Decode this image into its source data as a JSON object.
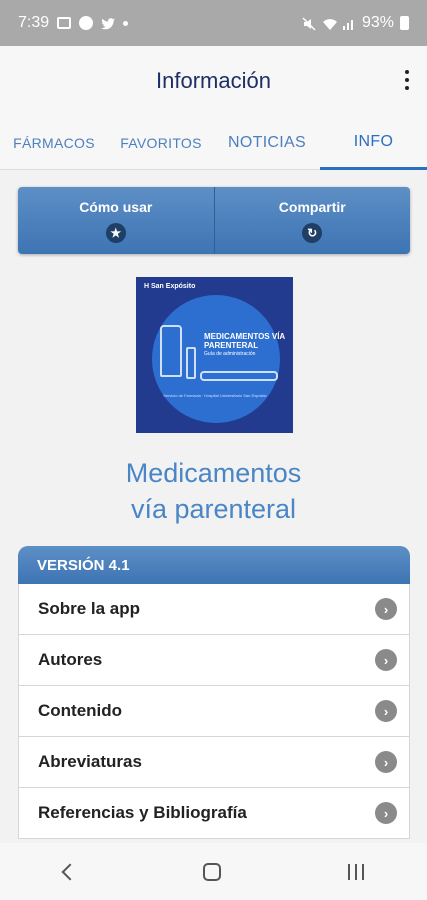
{
  "status_bar": {
    "time": "7:39",
    "battery": "93%"
  },
  "header": {
    "title": "Información"
  },
  "tabs": [
    {
      "label": "FÁRMACOS"
    },
    {
      "label": "FAVORITOS"
    },
    {
      "label": "NOTICIAS"
    },
    {
      "label": "INFO",
      "active": true
    }
  ],
  "actions": [
    {
      "label": "Cómo usar",
      "icon": "star-icon"
    },
    {
      "label": "Compartir",
      "icon": "share-icon"
    }
  ],
  "logo": {
    "header_text": "H San Expósito",
    "title": "MEDICAMENTOS VÍA PARENTERAL",
    "subtitle": "Guía de administración",
    "footer": "Servicio de Farmacia · Hospital Universitario San Expósito"
  },
  "app_name": {
    "line1": "Medicamentos",
    "line2": "vía parenteral"
  },
  "version": {
    "header": "VERSIÓN 4.1",
    "items": [
      {
        "label": "Sobre la app"
      },
      {
        "label": "Autores"
      },
      {
        "label": "Contenido"
      },
      {
        "label": "Abreviaturas"
      },
      {
        "label": "Referencias y Bibliografía"
      }
    ]
  },
  "colors": {
    "accent": "#3d74b3",
    "title": "#1e2f66",
    "tab": "#4d7fbf"
  }
}
